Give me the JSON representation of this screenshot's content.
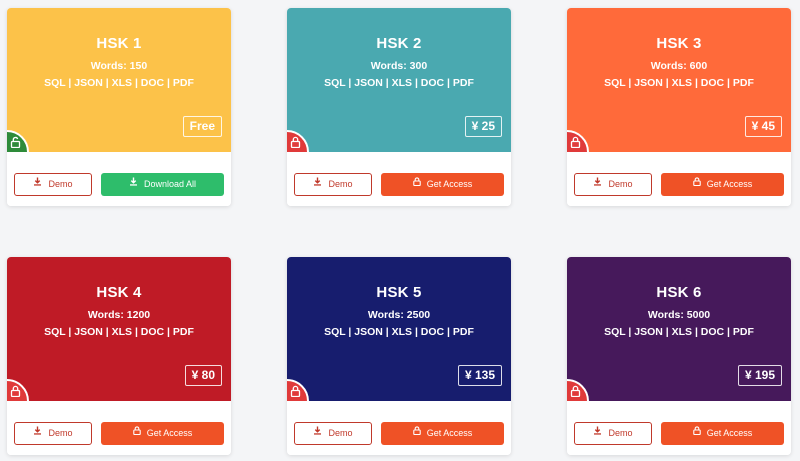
{
  "cards": [
    {
      "title": "HSK 1",
      "words": "Words: 150",
      "formats": "SQL | JSON | XLS | DOC | PDF",
      "price": "Free",
      "color": "#fcc249",
      "lock_color": "#2e8b3a",
      "lock_icon": "unlocked-icon",
      "demo_label": "Demo",
      "action_label": "Download All",
      "action_icon": "download-icon",
      "action_color": "#2ebd6b"
    },
    {
      "title": "HSK 2",
      "words": "Words: 300",
      "formats": "SQL | JSON | XLS | DOC | PDF",
      "price": "¥ 25",
      "color": "#4aa9b0",
      "lock_color": "#e03a3a",
      "lock_icon": "lock-icon",
      "demo_label": "Demo",
      "action_label": "Get Access",
      "action_icon": "lock-icon",
      "action_color": "#ef5226"
    },
    {
      "title": "HSK 3",
      "words": "Words: 600",
      "formats": "SQL | JSON | XLS | DOC | PDF",
      "price": "¥ 45",
      "color": "#ff6a3a",
      "lock_color": "#e03a3a",
      "lock_icon": "lock-icon",
      "demo_label": "Demo",
      "action_label": "Get Access",
      "action_icon": "lock-icon",
      "action_color": "#ef5226"
    },
    {
      "title": "HSK 4",
      "words": "Words: 1200",
      "formats": "SQL | JSON | XLS | DOC | PDF",
      "price": "¥ 80",
      "color": "#bf1b26",
      "lock_color": "#e03a3a",
      "lock_icon": "lock-icon",
      "demo_label": "Demo",
      "action_label": "Get Access",
      "action_icon": "lock-icon",
      "action_color": "#ef5226"
    },
    {
      "title": "HSK 5",
      "words": "Words: 2500",
      "formats": "SQL | JSON | XLS | DOC | PDF",
      "price": "¥ 135",
      "color": "#171d6e",
      "lock_color": "#e03a3a",
      "lock_icon": "lock-icon",
      "demo_label": "Demo",
      "action_label": "Get Access",
      "action_icon": "lock-icon",
      "action_color": "#ef5226"
    },
    {
      "title": "HSK 6",
      "words": "Words: 5000",
      "formats": "SQL | JSON | XLS | DOC | PDF",
      "price": "¥ 195",
      "color": "#46195b",
      "lock_color": "#e03a3a",
      "lock_icon": "lock-icon",
      "demo_label": "Demo",
      "action_label": "Get Access",
      "action_icon": "lock-icon",
      "action_color": "#ef5226"
    }
  ]
}
